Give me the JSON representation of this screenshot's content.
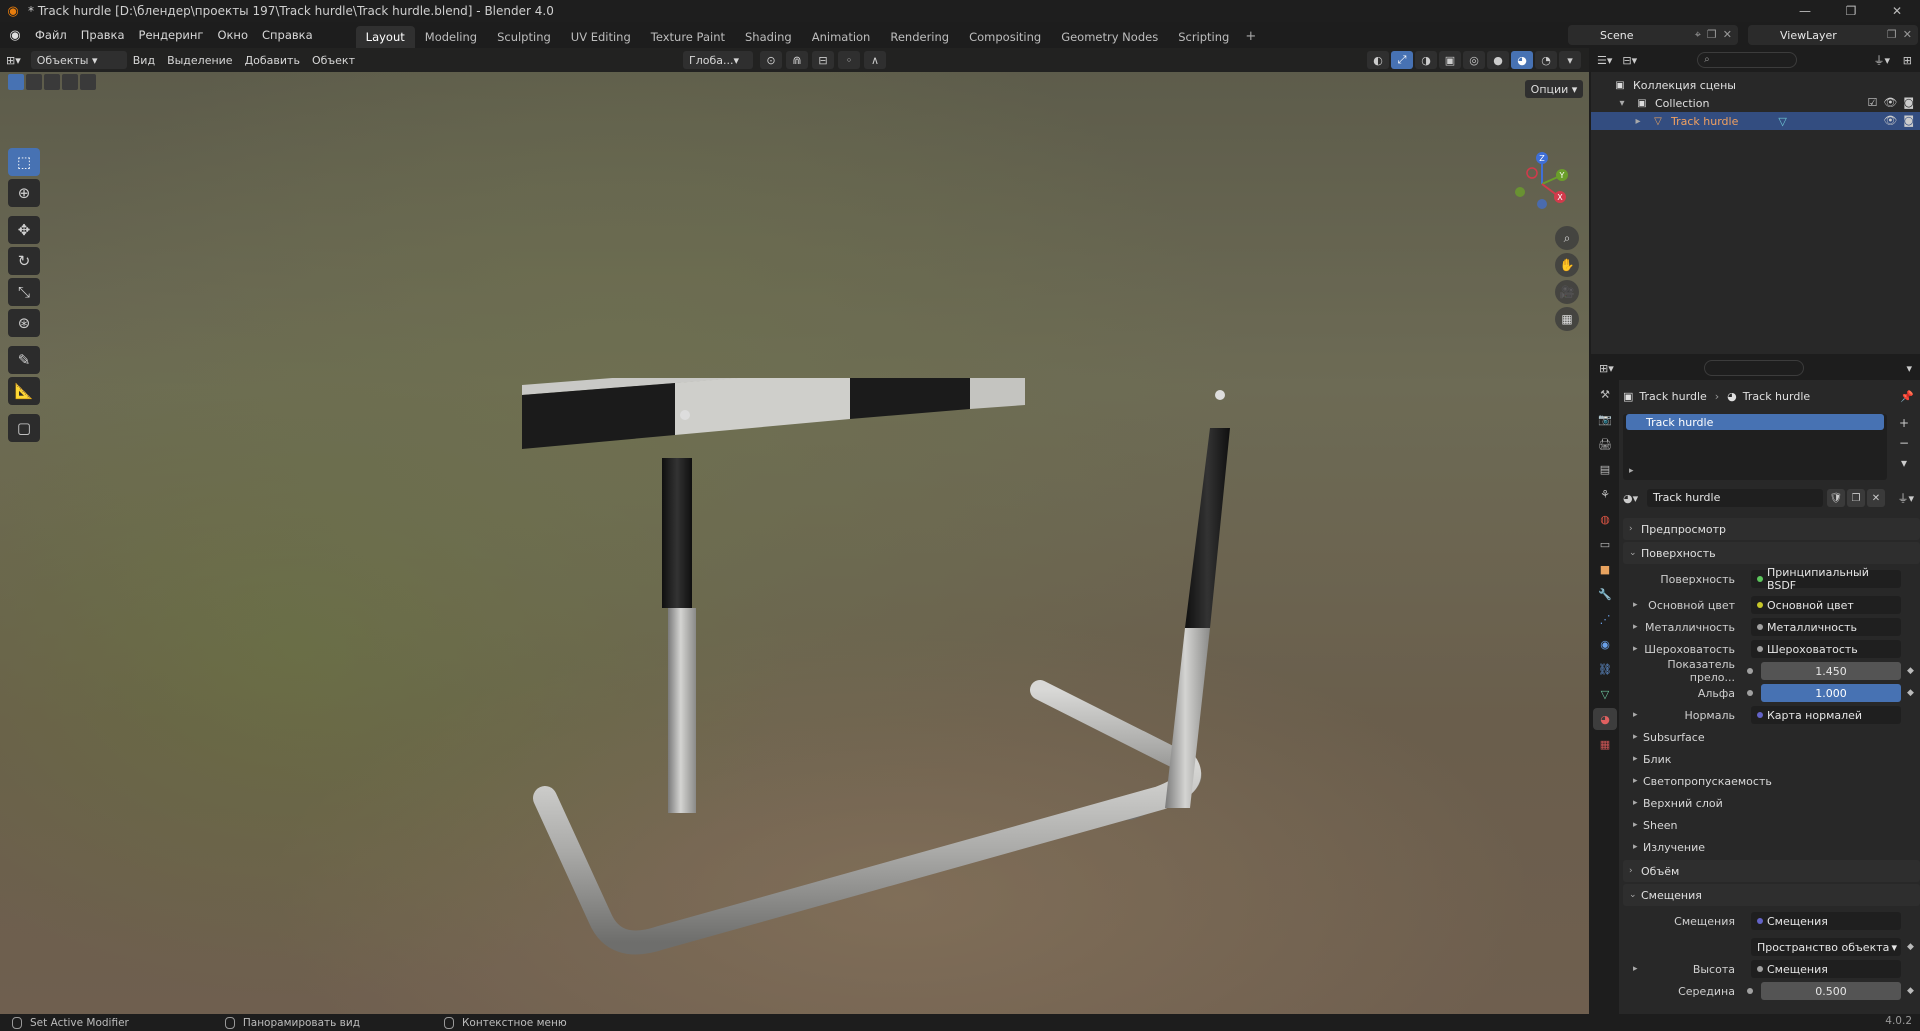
{
  "window": {
    "title": "* Track hurdle [D:\\блендер\\проекты 197\\Track hurdle\\Track hurdle.blend] - Blender 4.0"
  },
  "menus": [
    "Файл",
    "Правка",
    "Рендеринг",
    "Окно",
    "Справка"
  ],
  "workspaces": [
    {
      "label": "Layout",
      "active": true
    },
    {
      "label": "Modeling",
      "active": false
    },
    {
      "label": "Sculpting",
      "active": false
    },
    {
      "label": "UV Editing",
      "active": false
    },
    {
      "label": "Texture Paint",
      "active": false
    },
    {
      "label": "Shading",
      "active": false
    },
    {
      "label": "Animation",
      "active": false
    },
    {
      "label": "Rendering",
      "active": false
    },
    {
      "label": "Compositing",
      "active": false
    },
    {
      "label": "Geometry Nodes",
      "active": false
    },
    {
      "label": "Scripting",
      "active": false
    }
  ],
  "scene": {
    "label": "Scene"
  },
  "view_layer": {
    "label": "ViewLayer"
  },
  "viewport": {
    "mode": "Объекты",
    "menu": [
      "Вид",
      "Выделение",
      "Добавить",
      "Объект"
    ],
    "orientation": "Глоба...",
    "options_label": "Опции",
    "gizmo": {
      "z": "Z",
      "y": "Y",
      "x": "X"
    }
  },
  "outliner": {
    "rows": [
      {
        "label": "Коллекция сцены",
        "level": 0
      },
      {
        "label": "Collection",
        "level": 1
      },
      {
        "label": "Track hurdle",
        "level": 2,
        "selected": true
      }
    ]
  },
  "properties": {
    "breadcrumb": [
      "Track hurdle",
      "Track hurdle"
    ],
    "slot": "Track hurdle",
    "material_name": "Track hurdle",
    "panels": {
      "preview": "Предпросмотр",
      "surface": "Поверхность",
      "volume": "Объём",
      "displacement": "Смещения"
    },
    "surface": {
      "surface_label": "Поверхность",
      "surface_value": "Принципиальный BSDF",
      "base_color_label": "Основной цвет",
      "base_color_value": "Основной цвет",
      "metallic_label": "Металличность",
      "metallic_value": "Металличность",
      "roughness_label": "Шероховатость",
      "roughness_value": "Шероховатость",
      "ior_label": "Показатель прело...",
      "ior_value": "1.450",
      "alpha_label": "Альфа",
      "alpha_value": "1.000",
      "normal_label": "Нормаль",
      "normal_value": "Карта нормалей",
      "subitems": [
        "Subsurface",
        "Блик",
        "Светопропускаемость",
        "Верхний слой",
        "Sheen",
        "Излучение"
      ]
    },
    "displacement": {
      "disp_label": "Смещения",
      "disp_value": "Смещения",
      "space_value": "Пространство объекта",
      "height_label": "Высота",
      "height_value": "Смещения",
      "midlevel_label": "Середина",
      "midlevel_value": "0.500"
    }
  },
  "statusbar": {
    "left": "Set Active Modifier",
    "middle": "Панорамировать вид",
    "right": "Контекстное меню",
    "version": "4.0.2"
  },
  "colors": {
    "accent": "#4772b3",
    "selected_row": "#334d80",
    "logo": "#e87d0d"
  }
}
